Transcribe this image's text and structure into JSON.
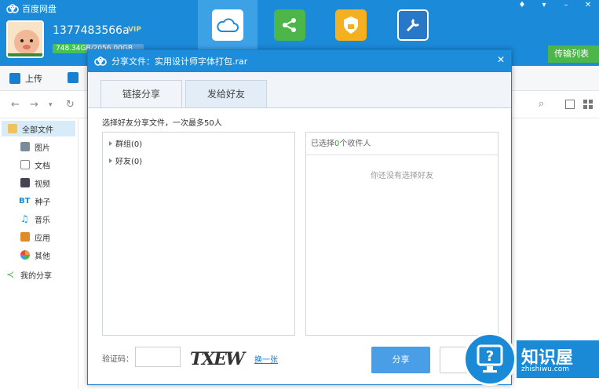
{
  "app": {
    "title": "百度网盘"
  },
  "user": {
    "name": "1377483566a",
    "vip": "VIP",
    "quota_text": "748.34GB/2056.00GB",
    "quota_fraction": 0.36
  },
  "header": {
    "transfer_list": "传输列表"
  },
  "toolbar": {
    "upload": "上传"
  },
  "sidebar": {
    "items": [
      {
        "label": "全部文件",
        "icon": "folder-icon"
      },
      {
        "label": "图片",
        "icon": "image-icon"
      },
      {
        "label": "文档",
        "icon": "document-icon"
      },
      {
        "label": "视频",
        "icon": "video-icon"
      },
      {
        "label": "种子",
        "icon": "bt-icon",
        "prefix": "BT"
      },
      {
        "label": "音乐",
        "icon": "music-icon"
      },
      {
        "label": "应用",
        "icon": "app-icon"
      },
      {
        "label": "其他",
        "icon": "other-icon"
      },
      {
        "label": "我的分享",
        "icon": "share-icon"
      }
    ]
  },
  "dialog": {
    "title": "分享文件：实用设计师字体打包.rar",
    "tabs": [
      "链接分享",
      "发给好友"
    ],
    "hint": "选择好友分享文件，一次最多50人",
    "tree": [
      "群组(0)",
      "好友(0)"
    ],
    "selected_prefix": "已选择",
    "selected_count": "0",
    "selected_suffix": "个收件人",
    "empty_text": "你还没有选择好友",
    "captcha_label": "验证码：",
    "captcha_text": "TXEW",
    "refresh_label": "换一张",
    "share_button": "分享"
  },
  "watermark": {
    "main": "知识屋",
    "sub": "zhishiwu.com"
  },
  "colors": {
    "header_blue": "#1b8ad8",
    "dialog_blue": "#1d8ddb",
    "accent_green": "#47c05a",
    "button_blue": "#4a9ee6"
  }
}
